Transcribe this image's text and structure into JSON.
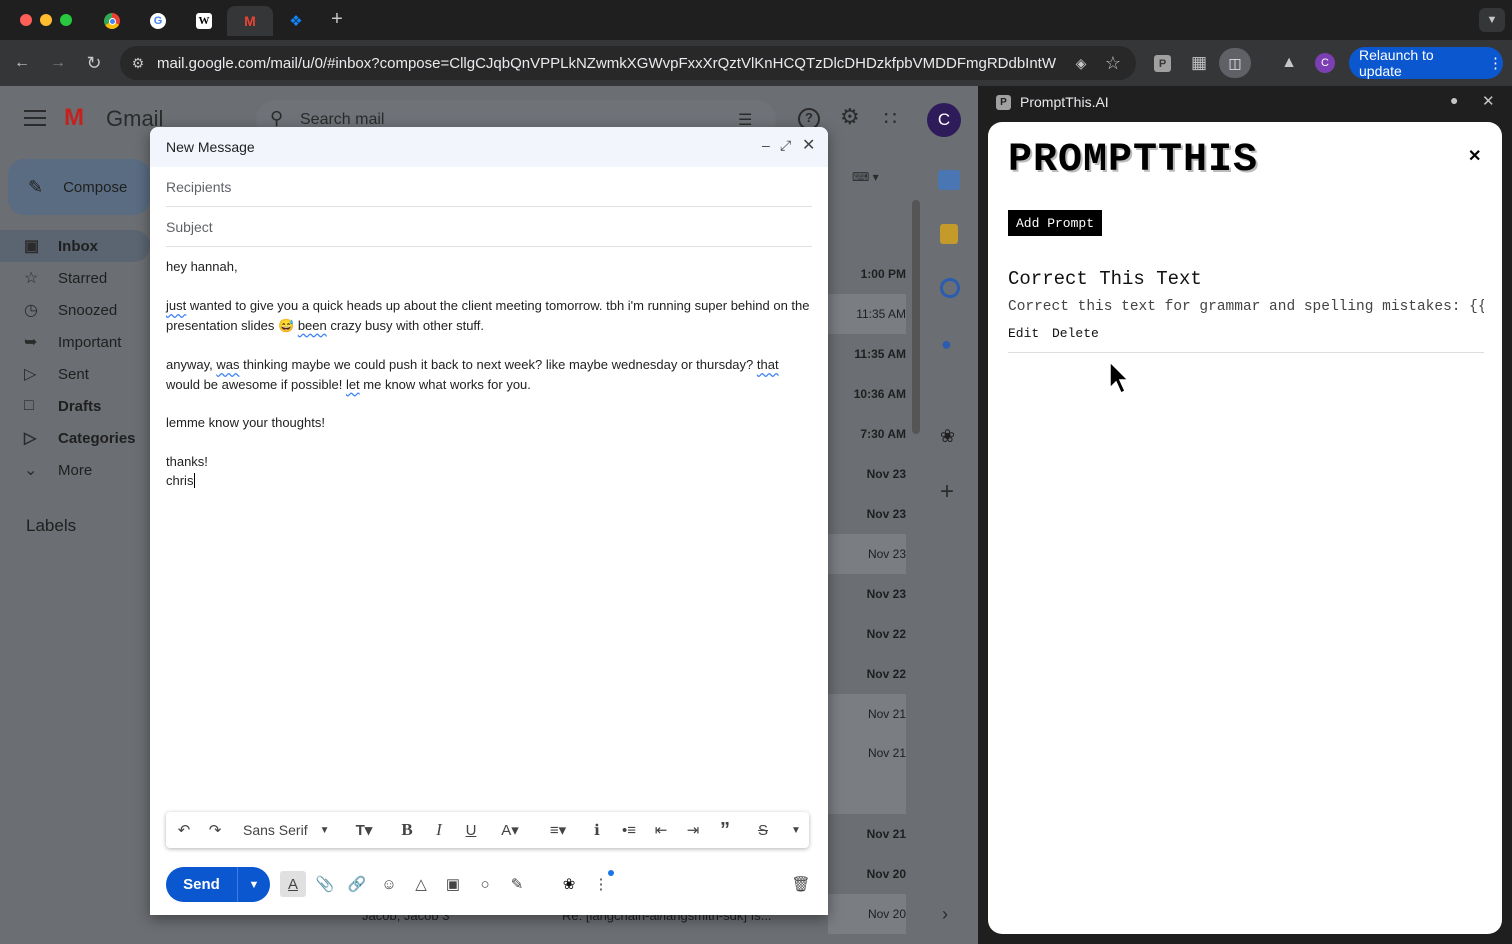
{
  "browser": {
    "url": "mail.google.com/mail/u/0/#inbox?compose=CllgCJqbQnVPPLkNZwmkXGWvpFxxXrQztVlKnHCQTzDlcDHDzkfpbVMDDFmgRDdbIntWKj...",
    "relaunch_label": "Relaunch to update",
    "profile_initial": "C"
  },
  "gmail": {
    "logo": "Gmail",
    "search_placeholder": "Search mail",
    "compose_label": "Compose",
    "nav": [
      "Inbox",
      "Starred",
      "Snoozed",
      "Important",
      "Sent",
      "Drafts",
      "Categories",
      "More"
    ],
    "labels_heading": "Labels",
    "avatar_initial": "C",
    "row_dates": [
      "1:00 PM",
      "11:35 AM",
      "11:35 AM",
      "10:36 AM",
      "7:30 AM",
      "Nov 23",
      "Nov 23",
      "Nov 23",
      "Nov 23",
      "Nov 22",
      "Nov 22",
      "Nov 21",
      "Nov 21",
      "Nov 21",
      "Nov 20",
      "Nov 20"
    ],
    "partial_row_sender": "Jacob, Jacob 3",
    "partial_row_subject": "Re: [langchain-ai/langsmith-sdk] Is..."
  },
  "compose": {
    "title": "New Message",
    "recipients_placeholder": "Recipients",
    "subject_placeholder": "Subject",
    "body": {
      "greeting": "hey hannah,",
      "p1_a": "just",
      "p1_b": " wanted to give you a quick heads up about the client meeting tomorrow. tbh i'm running super behind on the presentation slides ",
      "p1_emoji": "😅",
      "p1_c": "been",
      "p1_d": " crazy busy with other stuff.",
      "p2_a": "anyway, ",
      "p2_b": "was",
      "p2_c": " thinking maybe we could push it back to next week? like maybe wednesday or thursday? ",
      "p2_d": "that",
      "p2_e": " would be awesome if possible! ",
      "p2_f": "let",
      "p2_g": " me know what works for you.",
      "p3": "lemme know your thoughts!",
      "signoff": "thanks!",
      "name": "chris"
    },
    "font_name": "Sans Serif",
    "send_label": "Send"
  },
  "panel": {
    "title": "PromptThis.AI",
    "logo_text": "PROMPTTHIS",
    "add_button": "Add Prompt",
    "prompt": {
      "title": "Correct This Text",
      "text": "Correct this text for grammar and spelling mistakes: {{…",
      "edit": "Edit",
      "delete": "Delete"
    }
  }
}
